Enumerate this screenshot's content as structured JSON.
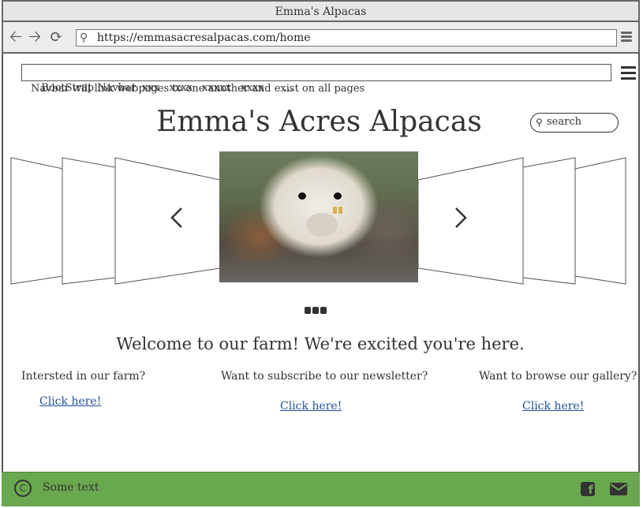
{
  "window": {
    "title": "Emma's Alpacas"
  },
  "browser": {
    "back_icon": "arrow-left-icon",
    "forward_icon": "arrow-right-icon",
    "reload_icon": "reload-icon",
    "url": "https://emmasacresalpacas.com/home"
  },
  "navbar": {
    "text": "BootStrap Navbar  xxx   xxxx   xxxxx   xxxx      ...",
    "note": "Navbar will link webpages to one another and exist on all pages"
  },
  "header": {
    "site_title": "Emma's Acres Alpacas",
    "search_placeholder": "search"
  },
  "carousel": {
    "prev_icon": "chevron-left-icon",
    "next_icon": "chevron-right-icon",
    "slide_count": 3,
    "active_image": "alpaca-photo"
  },
  "main": {
    "welcome": "Welcome to our farm! We're excited you're here.",
    "columns": [
      {
        "question": "Intersted in our farm?",
        "link": "Click here!"
      },
      {
        "question": "Want to subscribe to our newsletter?",
        "link": "Click here!"
      },
      {
        "question": "Want to browse our gallery?",
        "link": "Click here!"
      }
    ]
  },
  "footer": {
    "copyright_icon": "copyright-icon",
    "text": "Some text",
    "facebook_icon": "facebook-icon",
    "mail_icon": "mail-icon",
    "background": "#6aa84f"
  }
}
